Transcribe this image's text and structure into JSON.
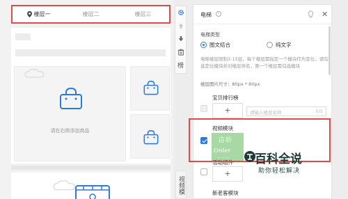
{
  "floor_tabs": [
    {
      "label": "楼层一",
      "active": true
    },
    {
      "label": "楼层二",
      "active": false
    },
    {
      "label": "楼层三",
      "active": false
    }
  ],
  "preview": {
    "hint": "请在右侧添加商品"
  },
  "toolbar": {
    "icons": [
      "gear-icon",
      "arrow-up-icon",
      "arrow-down-icon",
      "trash-icon"
    ],
    "label": "榜"
  },
  "side_label": "视频模",
  "panel": {
    "title": "电梯",
    "type_label": "电梯类型",
    "type_options": [
      {
        "label": "图文结合",
        "selected": true
      },
      {
        "label": "纯文字",
        "selected": false
      }
    ],
    "description": "电梯楼层限制3-15层，每个楼层需指定一个模块作为定位，请勾选定位模块并对楼层命名，第一个楼层需勾选模块",
    "size_note": "楼层图片尺寸：80px * 80px",
    "rows": [
      {
        "title": "宝贝排行榜",
        "checked": false,
        "disabled": true,
        "placeholder": "请输入楼层名称",
        "count": "0/5",
        "add": "+"
      },
      {
        "title": "视频模块",
        "checked": true,
        "disabled": false,
        "thumb_text": "Order",
        "thumb_cn": "店新"
      },
      {
        "title": "活动组件",
        "checked": false,
        "disabled": false,
        "add": "+"
      },
      {
        "title": "新老客模块",
        "checked": false,
        "disabled": false
      }
    ]
  },
  "watermark": {
    "title": "百科全说",
    "subtitle": "助你轻松解决"
  }
}
